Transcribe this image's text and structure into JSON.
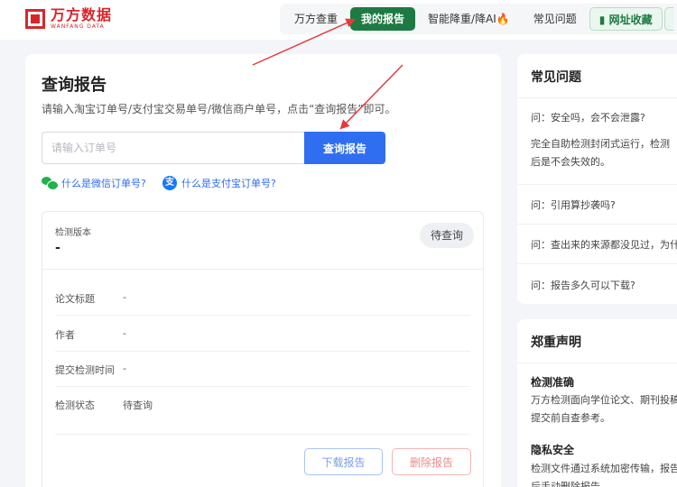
{
  "header": {
    "logo_cn": "万方数据",
    "logo_en": "WANFANG DATA",
    "nav": [
      {
        "label": "万方查重"
      },
      {
        "label": "我的报告"
      },
      {
        "label": "智能降重/降AI🔥"
      },
      {
        "label": "常见问题"
      },
      {
        "label": "网址收藏"
      }
    ]
  },
  "query": {
    "title": "查询报告",
    "hint": "请输入淘宝订单号/支付宝交易单号/微信商户单号，点击“查询报告”即可。",
    "input_placeholder": "请输入订单号",
    "input_value": "",
    "button_label": "查询报告",
    "wechat_help": "什么是微信订单号?",
    "alipay_help": "什么是支付宝订单号?",
    "alipay_icon_glyph": "支"
  },
  "report": {
    "version_label": "检测版本",
    "version_value": "-",
    "status_pill": "待查询",
    "rows": [
      {
        "label": "论文标题",
        "value": "-"
      },
      {
        "label": "作者",
        "value": "-"
      },
      {
        "label": "提交检测时间",
        "value": "-"
      },
      {
        "label": "检测状态",
        "value": "待查询"
      }
    ],
    "download_label": "下载报告",
    "delete_label": "删除报告"
  },
  "faq": {
    "title": "常见问题",
    "items": [
      {
        "q": "问：安全吗，会不会泄露?"
      },
      {
        "q": "问：引用算抄袭吗?"
      },
      {
        "q": "问：查出来的来源都没见过，为什"
      },
      {
        "q": "问：报告多久可以下载?"
      }
    ],
    "answer": "完全自助检测封闭式运行，检测后是不会失效的。"
  },
  "declaration": {
    "title": "郑重声明",
    "sections": [
      {
        "heading": "检测准确",
        "text": "万方检测面向学位论文、期刊投稿提交前自查参考。"
      },
      {
        "heading": "隐私安全",
        "text": "检测文件通过系统加密传输，报告后手动删除报告。"
      }
    ]
  },
  "colors": {
    "brand_red": "#d8262b",
    "nav_active": "#1e7a43",
    "primary_blue": "#2f6ef0",
    "annotation_arrow": "#e63a3a"
  }
}
